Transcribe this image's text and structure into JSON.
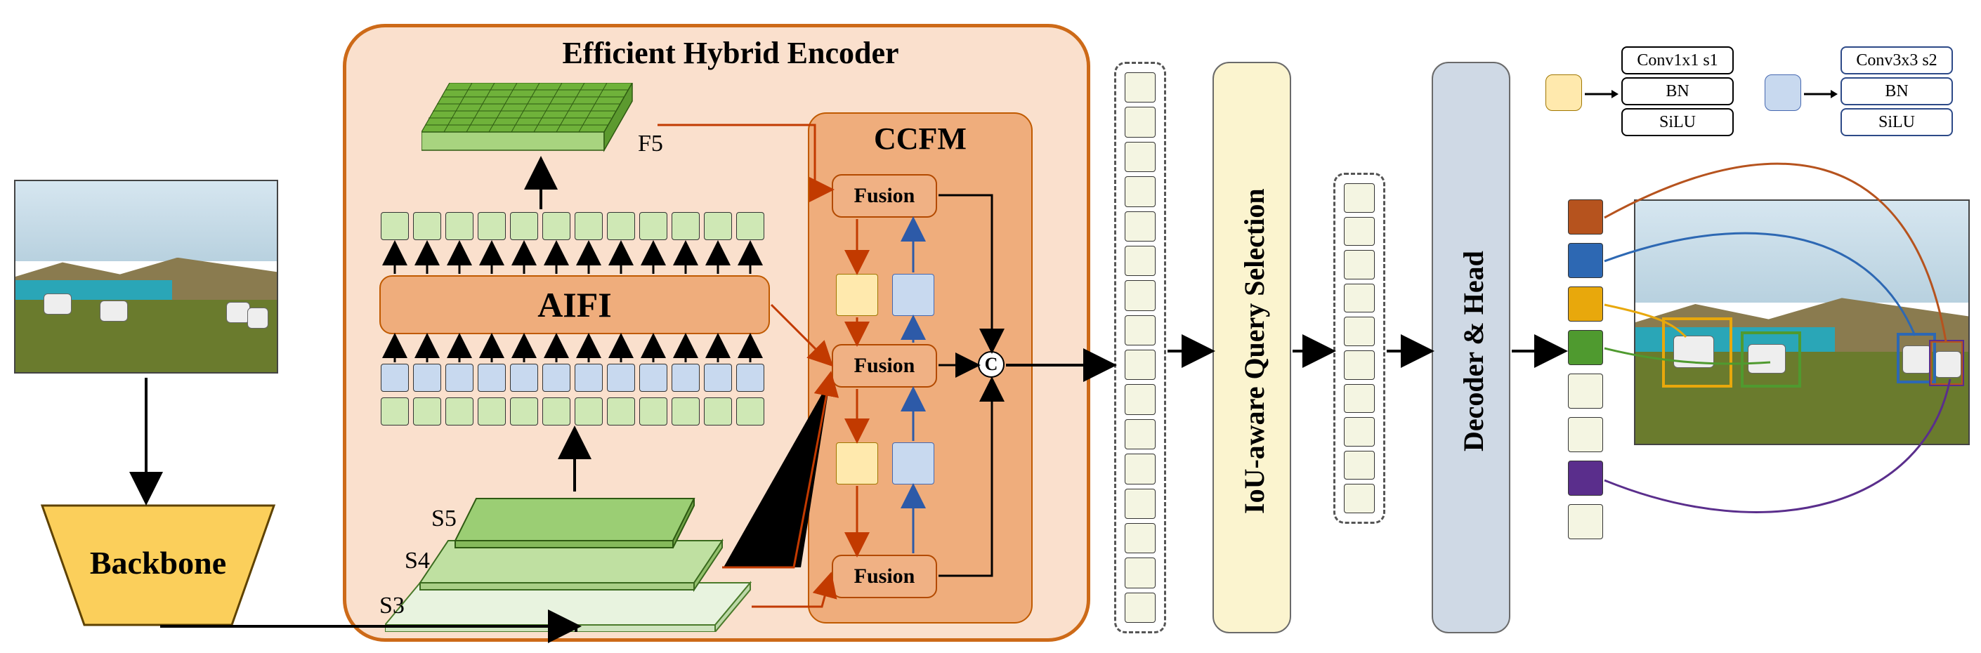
{
  "encoder": {
    "title": "Efficient Hybrid Encoder",
    "aifi_label": "AIFI",
    "ccfm_label": "CCFM",
    "fusion_label": "Fusion",
    "feature_labels": {
      "f5": "F5",
      "s5": "S5",
      "s4": "S4",
      "s3": "S3"
    }
  },
  "backbone_label": "Backbone",
  "query_selection_label": "IoU-aware Query Selection",
  "decoder_label": "Decoder & Head",
  "concat_symbol": "C",
  "legend": {
    "yellow_ops": [
      "Conv1x1 s1",
      "BN",
      "SiLU"
    ],
    "blue_ops": [
      "Conv3x3 s2",
      "BN",
      "SiLU"
    ]
  },
  "detections": {
    "colors": [
      "#b6531e",
      "#2d68b3",
      "#e8a80c",
      "#4f9a2f",
      "#5a2e8c"
    ]
  }
}
